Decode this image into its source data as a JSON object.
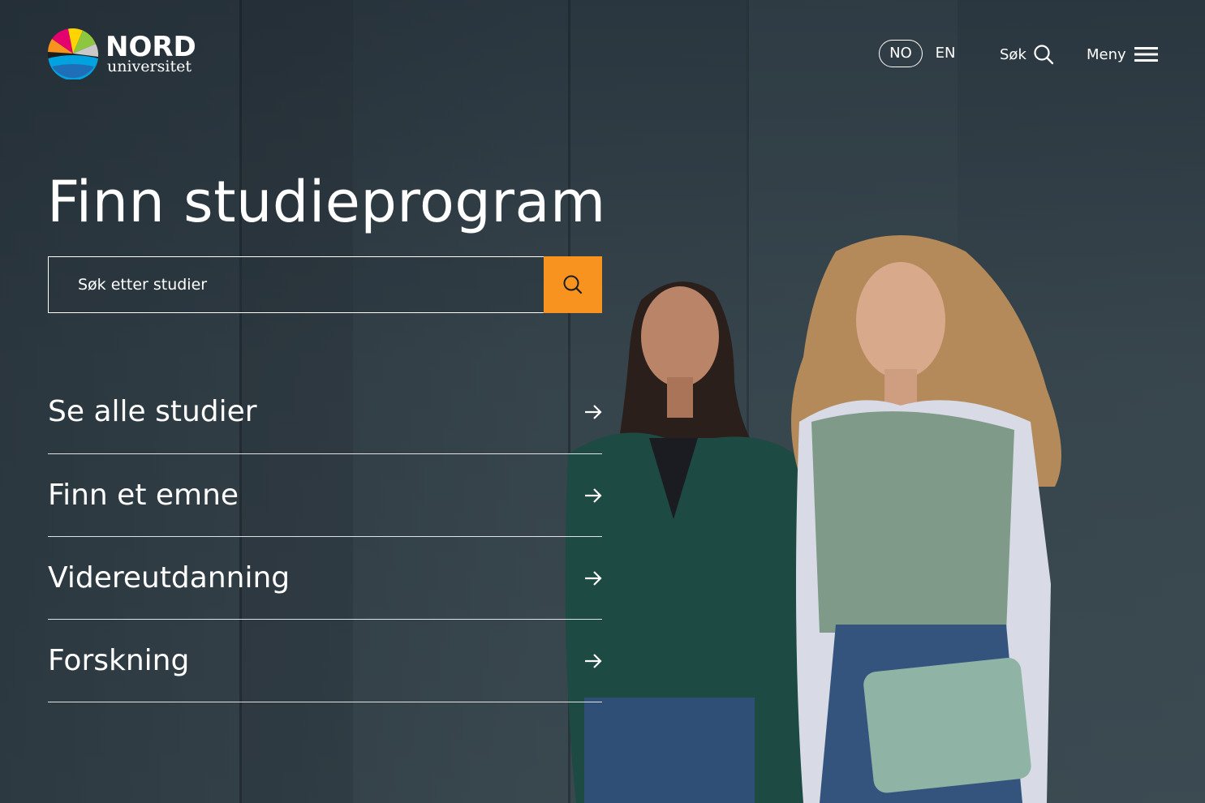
{
  "brand": {
    "name": "NORD",
    "subtitle": "universitet",
    "logo_colors": [
      "#e4006d",
      "#f7931e",
      "#ffd400",
      "#8dc63f",
      "#00a3e0",
      "#1d1d1b"
    ]
  },
  "header": {
    "languages": [
      {
        "label": "NO",
        "selected": true
      },
      {
        "label": "EN",
        "selected": false
      }
    ],
    "search_label": "Søk",
    "menu_label": "Meny"
  },
  "hero": {
    "title": "Finn studieprogram",
    "search": {
      "placeholder": "Søk etter studier",
      "value": "",
      "button_color": "#f7931e"
    }
  },
  "links": [
    {
      "label": "Se alle studier"
    },
    {
      "label": "Finn et emne"
    },
    {
      "label": "Videreutdanning"
    },
    {
      "label": "Forskning"
    }
  ]
}
